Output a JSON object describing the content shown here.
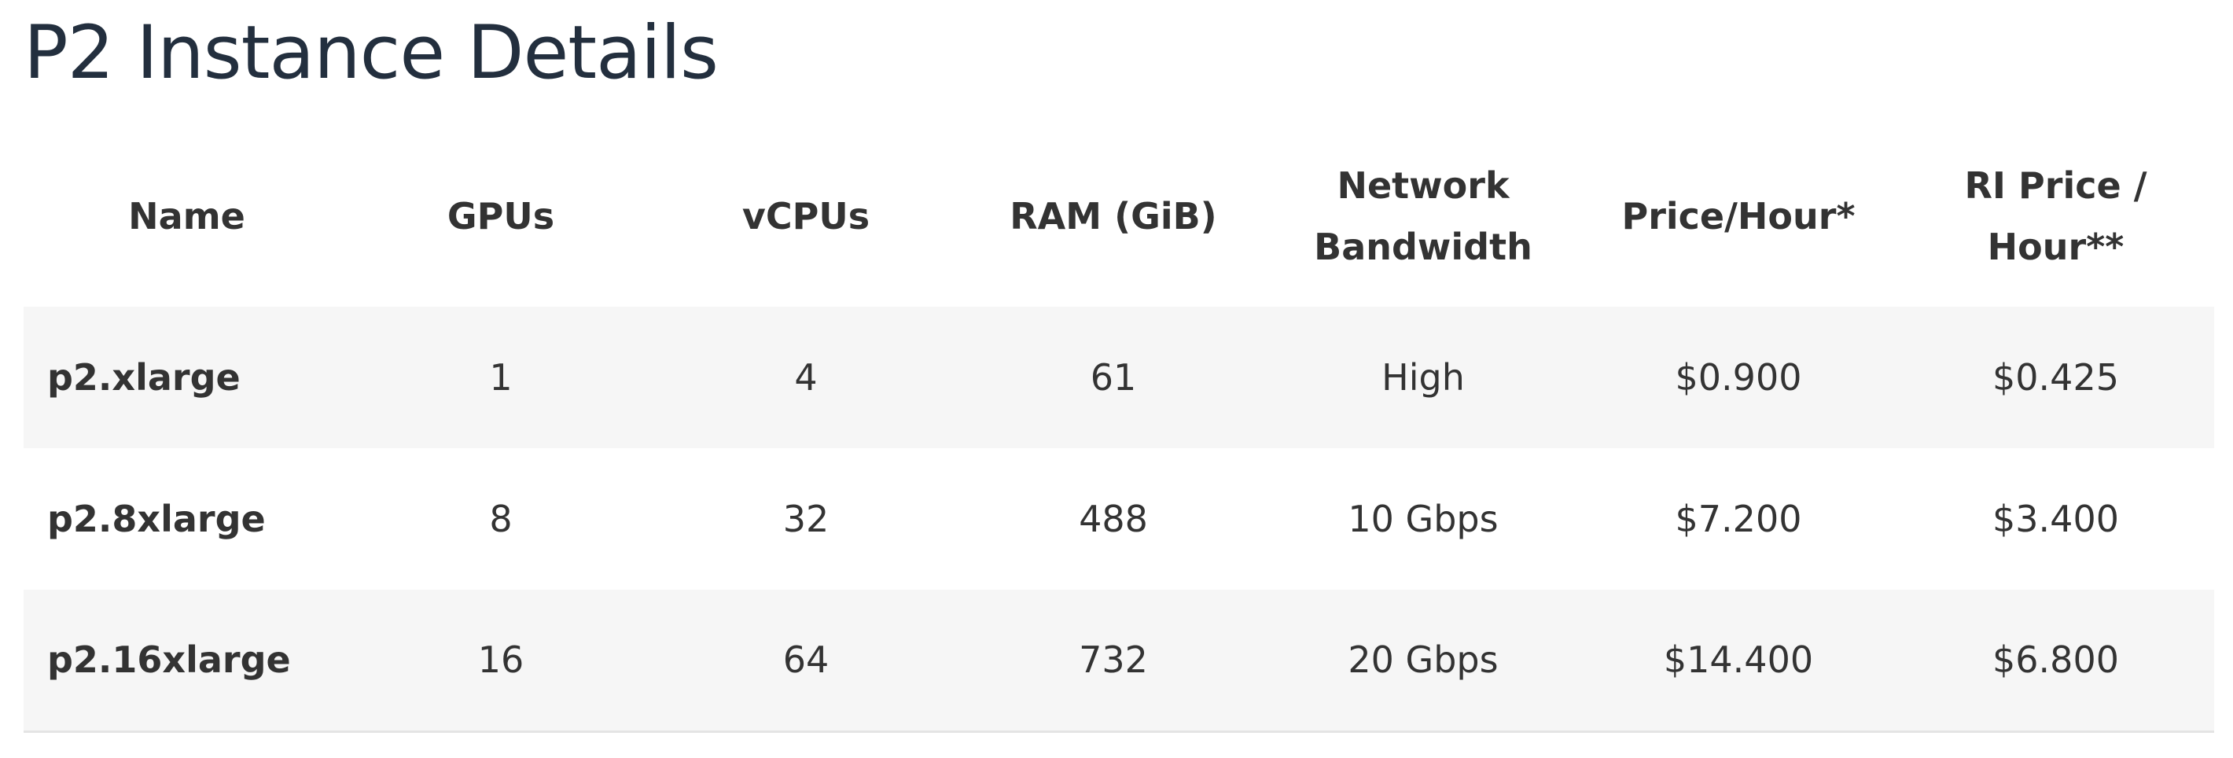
{
  "page": {
    "title": "P2 Instance Details"
  },
  "table": {
    "headers": {
      "name": "Name",
      "gpus": "GPUs",
      "vcpus": "vCPUs",
      "ram": "RAM (GiB)",
      "network_line1": "Network",
      "network_line2": "Bandwidth",
      "price": "Price/Hour*",
      "ri_line1": "RI Price /",
      "ri_line2": "Hour**"
    },
    "rows": [
      {
        "name": "p2.xlarge",
        "gpus": "1",
        "vcpus": "4",
        "ram": "61",
        "network": "High",
        "price": "$0.900",
        "ri_price": "$0.425"
      },
      {
        "name": "p2.8xlarge",
        "gpus": "8",
        "vcpus": "32",
        "ram": "488",
        "network": "10 Gbps",
        "price": "$7.200",
        "ri_price": "$3.400"
      },
      {
        "name": "p2.16xlarge",
        "gpus": "16",
        "vcpus": "64",
        "ram": "732",
        "network": "20 Gbps",
        "price": "$14.400",
        "ri_price": "$6.800"
      }
    ]
  },
  "colors": {
    "title": "#232f3e",
    "text": "#333333",
    "row_stripe": "#f6f6f6",
    "row_plain": "#ffffff",
    "bottom_border": "#e4e4e4"
  }
}
